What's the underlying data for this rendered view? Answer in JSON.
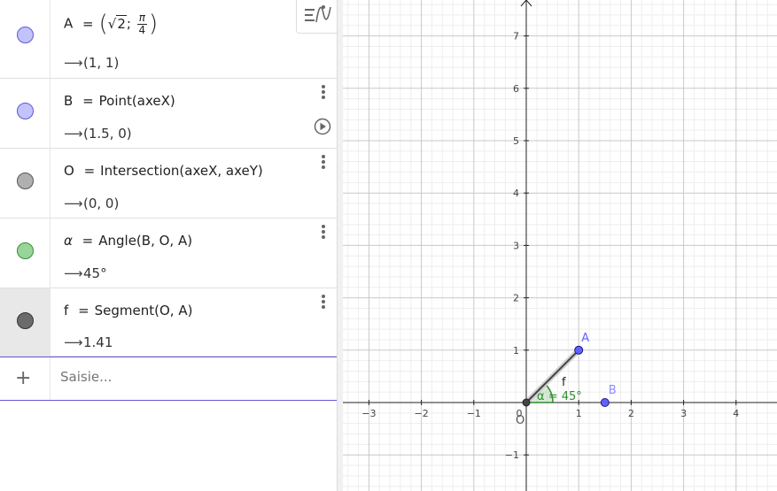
{
  "algebra": {
    "rows": [
      {
        "lhs": "A",
        "eq": "=",
        "def_parts": {
          "sqrt_arg": "2",
          "sep": ";",
          "pi": "π",
          "den": "4"
        },
        "output": "(1, 1)",
        "color": "#b5b5ff"
      },
      {
        "lhs": "B",
        "eq": "=",
        "def": "Point(axeX)",
        "output": "(1.5, 0)",
        "color": "#b5b5ff"
      },
      {
        "lhs": "O",
        "eq": "=",
        "def": "Intersection(axeX, axeY)",
        "output": "(0, 0)",
        "color": "#a6a6a6"
      },
      {
        "lhs": "α",
        "eq": "=",
        "def": "Angle(B, O, A)",
        "output": "45°",
        "color": "#8fd58f"
      },
      {
        "lhs": "f",
        "eq": "=",
        "def": "Segment(O, A)",
        "output": "1.41",
        "color": "#666666"
      }
    ],
    "arrow": "⟶",
    "input_placeholder": "Saisie...",
    "add_icon": "plus-icon",
    "menu_icon": "more-vertical-icon",
    "play_icon": "play-icon",
    "toggle_icon": "algebra-view-toggle-icon"
  },
  "graphics": {
    "x_ticks": [
      "−3",
      "−2",
      "−1",
      "0",
      "1",
      "2",
      "3",
      "4"
    ],
    "y_ticks": [
      "7",
      "6",
      "5",
      "4",
      "3",
      "2",
      "1",
      "−1"
    ],
    "origin_label": "O",
    "point_A_label": "A",
    "point_B_label": "B",
    "segment_label": "f",
    "angle_label": "α = 45°",
    "point_color": "#6161ff",
    "angle_color": "#2e8b2e",
    "origin_color": "#444444"
  },
  "geometry": {
    "A": [
      1,
      1
    ],
    "B": [
      1.5,
      0
    ],
    "O": [
      0,
      0
    ],
    "alpha_deg": 45
  }
}
